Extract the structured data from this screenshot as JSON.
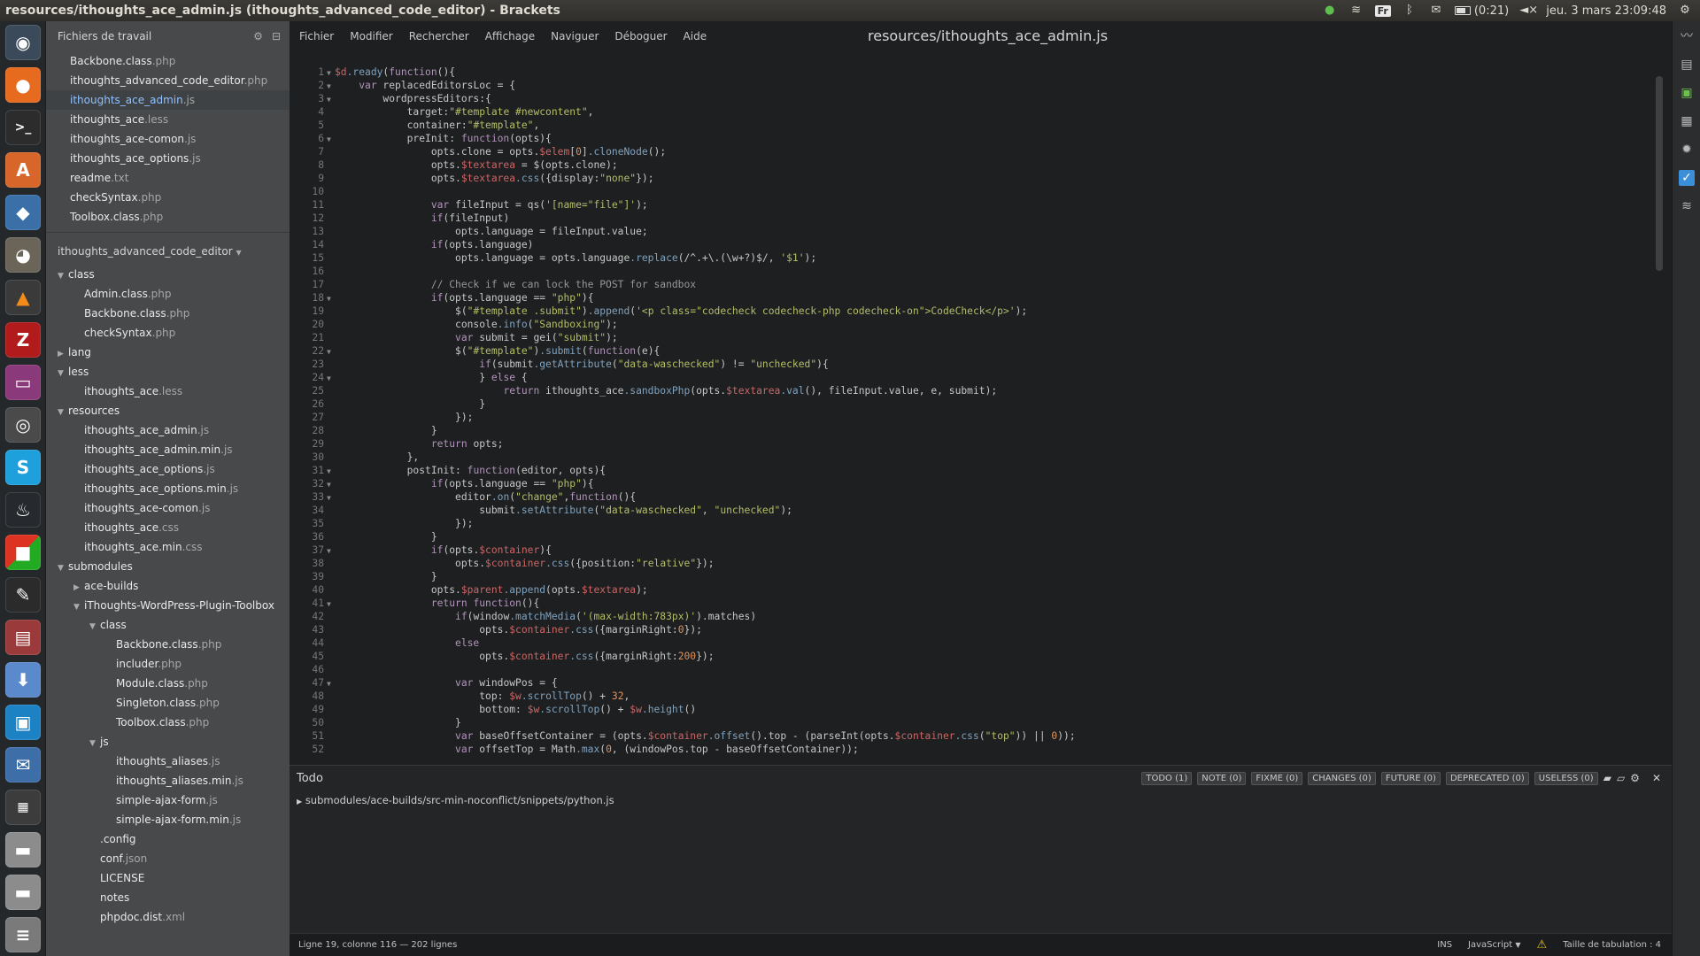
{
  "window": {
    "title": "resources/ithoughts_ace_admin.js (ithoughts_advanced_code_editor) - Brackets"
  },
  "tray": {
    "lang": "Fr",
    "battery": "(0:21)",
    "datetime": "jeu. 3 mars 23:09:48"
  },
  "sidebar": {
    "working_files_title": "Fichiers de travail",
    "working_files": [
      {
        "name": "Backbone.class",
        "ext": ".php",
        "active": false
      },
      {
        "name": "ithoughts_advanced_code_editor",
        "ext": ".php",
        "active": false
      },
      {
        "name": "ithoughts_ace_admin",
        "ext": ".js",
        "active": true
      },
      {
        "name": "ithoughts_ace",
        "ext": ".less",
        "active": false
      },
      {
        "name": "ithoughts_ace-comon",
        "ext": ".js",
        "active": false
      },
      {
        "name": "ithoughts_ace_options",
        "ext": ".js",
        "active": false
      },
      {
        "name": "readme",
        "ext": ".txt",
        "active": false
      },
      {
        "name": "checkSyntax",
        "ext": ".php",
        "active": false
      },
      {
        "name": "Toolbox.class",
        "ext": ".php",
        "active": false
      }
    ],
    "project_title": "ithoughts_advanced_code_editor",
    "tree": [
      {
        "name": "class",
        "ext": "",
        "indent": 0,
        "folder": "open"
      },
      {
        "name": "Admin.class",
        "ext": ".php",
        "indent": 1,
        "folder": ""
      },
      {
        "name": "Backbone.class",
        "ext": ".php",
        "indent": 1,
        "folder": ""
      },
      {
        "name": "checkSyntax",
        "ext": ".php",
        "indent": 1,
        "folder": ""
      },
      {
        "name": "lang",
        "ext": "",
        "indent": 0,
        "folder": "closed"
      },
      {
        "name": "less",
        "ext": "",
        "indent": 0,
        "folder": "open"
      },
      {
        "name": "ithoughts_ace",
        "ext": ".less",
        "indent": 1,
        "folder": ""
      },
      {
        "name": "resources",
        "ext": "",
        "indent": 0,
        "folder": "open"
      },
      {
        "name": "ithoughts_ace_admin",
        "ext": ".js",
        "indent": 1,
        "folder": ""
      },
      {
        "name": "ithoughts_ace_admin.min",
        "ext": ".js",
        "indent": 1,
        "folder": ""
      },
      {
        "name": "ithoughts_ace_options",
        "ext": ".js",
        "indent": 1,
        "folder": ""
      },
      {
        "name": "ithoughts_ace_options.min",
        "ext": ".js",
        "indent": 1,
        "folder": ""
      },
      {
        "name": "ithoughts_ace-comon",
        "ext": ".js",
        "indent": 1,
        "folder": ""
      },
      {
        "name": "ithoughts_ace",
        "ext": ".css",
        "indent": 1,
        "folder": ""
      },
      {
        "name": "ithoughts_ace.min",
        "ext": ".css",
        "indent": 1,
        "folder": ""
      },
      {
        "name": "submodules",
        "ext": "",
        "indent": 0,
        "folder": "open"
      },
      {
        "name": "ace-builds",
        "ext": "",
        "indent": 1,
        "folder": "closed"
      },
      {
        "name": "iThoughts-WordPress-Plugin-Toolbox",
        "ext": "",
        "indent": 1,
        "folder": "open"
      },
      {
        "name": "class",
        "ext": "",
        "indent": 2,
        "folder": "open"
      },
      {
        "name": "Backbone.class",
        "ext": ".php",
        "indent": 3,
        "folder": ""
      },
      {
        "name": "includer",
        "ext": ".php",
        "indent": 3,
        "folder": ""
      },
      {
        "name": "Module.class",
        "ext": ".php",
        "indent": 3,
        "folder": ""
      },
      {
        "name": "Singleton.class",
        "ext": ".php",
        "indent": 3,
        "folder": ""
      },
      {
        "name": "Toolbox.class",
        "ext": ".php",
        "indent": 3,
        "folder": ""
      },
      {
        "name": "js",
        "ext": "",
        "indent": 2,
        "folder": "open"
      },
      {
        "name": "ithoughts_aliases",
        "ext": ".js",
        "indent": 3,
        "folder": ""
      },
      {
        "name": "ithoughts_aliases.min",
        "ext": ".js",
        "indent": 3,
        "folder": ""
      },
      {
        "name": "simple-ajax-form",
        "ext": ".js",
        "indent": 3,
        "folder": ""
      },
      {
        "name": "simple-ajax-form.min",
        "ext": ".js",
        "indent": 3,
        "folder": ""
      },
      {
        "name": ".config",
        "ext": "",
        "indent": 2,
        "folder": ""
      },
      {
        "name": "conf",
        "ext": ".json",
        "indent": 2,
        "folder": ""
      },
      {
        "name": "LICENSE",
        "ext": "",
        "indent": 2,
        "folder": ""
      },
      {
        "name": "notes",
        "ext": "",
        "indent": 2,
        "folder": ""
      },
      {
        "name": "phpdoc.dist",
        "ext": ".xml",
        "indent": 2,
        "folder": ""
      }
    ]
  },
  "menubar": {
    "items": [
      "Fichier",
      "Modifier",
      "Rechercher",
      "Affichage",
      "Naviguer",
      "Déboguer",
      "Aide"
    ],
    "file_title": "resources/ithoughts_ace_admin.js"
  },
  "code": {
    "lines": [
      "$d.ready(function(){",
      "    var replacedEditorsLoc = {",
      "        wordpressEditors:{",
      "            target:\"#template #newcontent\",",
      "            container:\"#template\",",
      "            preInit: function(opts){",
      "                opts.clone = opts.$elem[0].cloneNode();",
      "                opts.$textarea = $(opts.clone);",
      "                opts.$textarea.css({display:\"none\"});",
      "",
      "                var fileInput = qs('[name=\"file\"]');",
      "                if(fileInput)",
      "                    opts.language = fileInput.value;",
      "                if(opts.language)",
      "                    opts.language = opts.language.replace(/^.+\\.(\\w+?)$/, '$1');",
      "",
      "                // Check if we can lock the POST for sandbox",
      "                if(opts.language == \"php\"){",
      "                    $(\"#template .submit\").append('<p class=\"codecheck codecheck-php codecheck-on\">CodeCheck</p>');",
      "                    console.info(\"Sandboxing\");",
      "                    var submit = gei(\"submit\");",
      "                    $(\"#template\").submit(function(e){",
      "                        if(submit.getAttribute(\"data-waschecked\") != \"unchecked\"){",
      "                        } else {",
      "                            return ithoughts_ace.sandboxPhp(opts.$textarea.val(), fileInput.value, e, submit);",
      "                        }",
      "                    });",
      "                }",
      "                return opts;",
      "            },",
      "            postInit: function(editor, opts){",
      "                if(opts.language == \"php\"){",
      "                    editor.on(\"change\",function(){",
      "                        submit.setAttribute(\"data-waschecked\", \"unchecked\");",
      "                    });",
      "                }",
      "                if(opts.$container){",
      "                    opts.$container.css({position:\"relative\"});",
      "                }",
      "                opts.$parent.append(opts.$textarea);",
      "                return function(){",
      "                    if(window.matchMedia('(max-width:783px)').matches)",
      "                        opts.$container.css({marginRight:0});",
      "                    else",
      "                        opts.$container.css({marginRight:200});",
      "",
      "                    var windowPos = {",
      "                        top: $w.scrollTop() + 32,",
      "                        bottom: $w.scrollTop() + $w.height()",
      "                    }",
      "                    var baseOffsetContainer = (opts.$container.offset().top - (parseInt(opts.$container.css(\"top\")) || 0));",
      "                    var offsetTop = Math.max(0, (windowPos.top - baseOffsetContainer));"
    ],
    "folds": [
      1,
      2,
      3,
      6,
      18,
      22,
      24,
      31,
      32,
      33,
      37,
      41,
      47
    ]
  },
  "todo": {
    "title": "Todo",
    "badges": [
      "TODO (1)",
      "NOTE (0)",
      "FIXME (0)",
      "CHANGES (0)",
      "FUTURE (0)",
      "DEPRECATED (0)",
      "USELESS (0)"
    ],
    "file": "submodules/ace-builds/src-min-noconflict/snippets/python.js"
  },
  "statusbar": {
    "position": "Ligne 19, colonne 116 — 202 lignes",
    "mode": "INS",
    "language": "JavaScript",
    "tab_size": "Taille de tabulation : 4"
  }
}
